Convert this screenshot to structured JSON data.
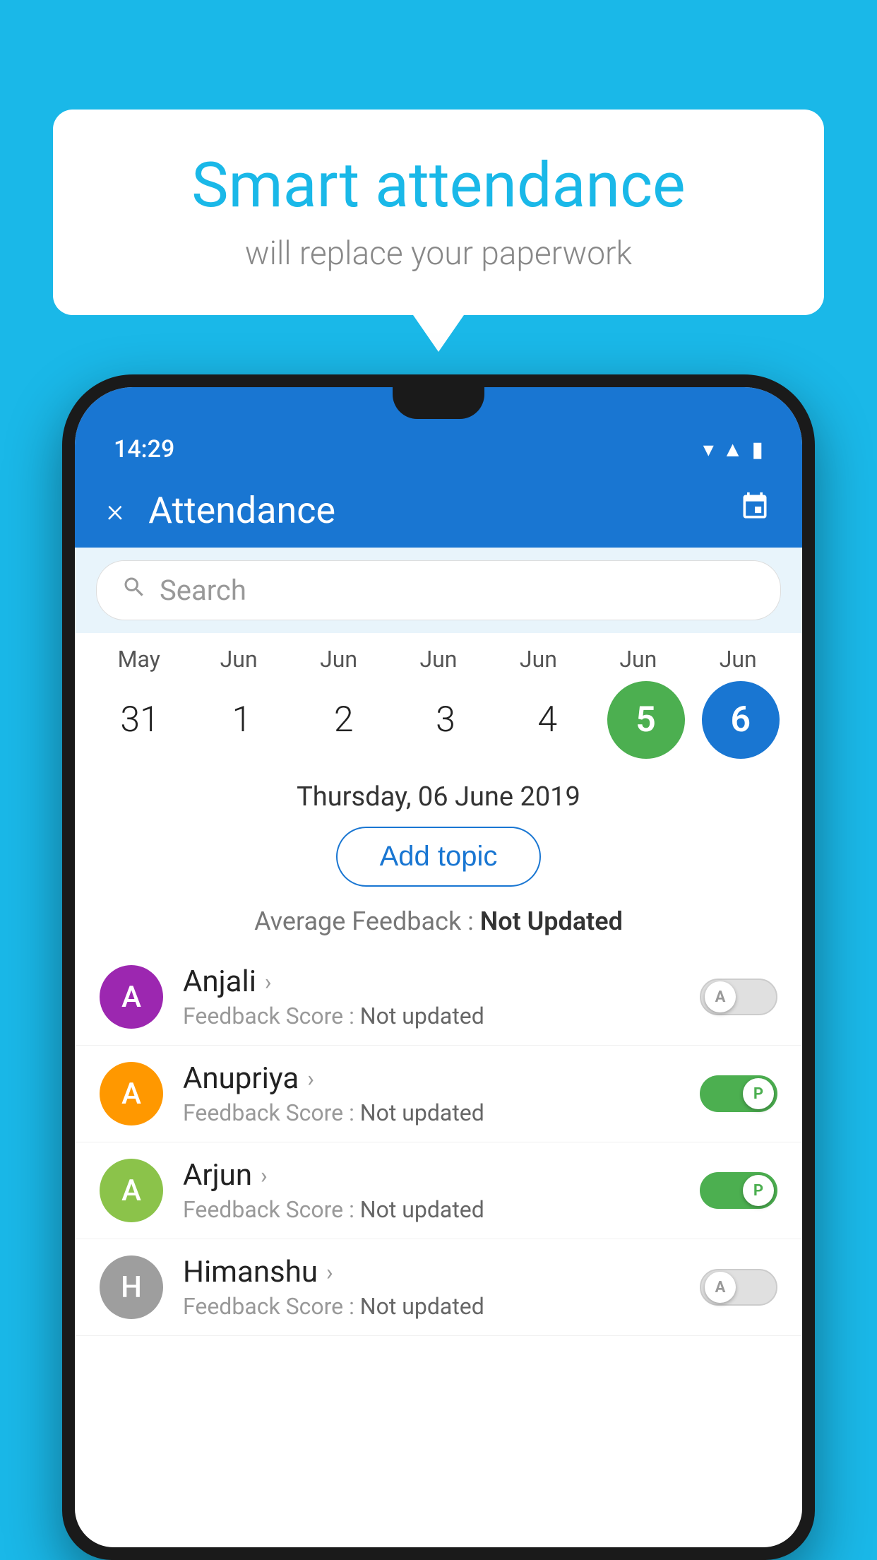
{
  "background_color": "#1ab8e8",
  "speech_bubble": {
    "title": "Smart attendance",
    "subtitle": "will replace your paperwork"
  },
  "status_bar": {
    "time": "14:29",
    "icons": [
      "wifi",
      "signal",
      "battery"
    ]
  },
  "app_bar": {
    "title": "Attendance",
    "close_label": "×",
    "calendar_icon": "📅"
  },
  "search": {
    "placeholder": "Search"
  },
  "calendar": {
    "months": [
      "May",
      "Jun",
      "Jun",
      "Jun",
      "Jun",
      "Jun",
      "Jun"
    ],
    "days": [
      "31",
      "1",
      "2",
      "3",
      "4",
      "5",
      "6"
    ],
    "active_green_index": 5,
    "active_blue_index": 6
  },
  "selected_date": "Thursday, 06 June 2019",
  "add_topic_label": "Add topic",
  "average_feedback": {
    "label": "Average Feedback :",
    "value": "Not Updated"
  },
  "students": [
    {
      "name": "Anjali",
      "initial": "A",
      "avatar_color": "#9c27b0",
      "feedback_label": "Feedback Score :",
      "feedback_value": "Not updated",
      "toggle_state": "off",
      "toggle_label": "A"
    },
    {
      "name": "Anupriya",
      "initial": "A",
      "avatar_color": "#ff9800",
      "feedback_label": "Feedback Score :",
      "feedback_value": "Not updated",
      "toggle_state": "on",
      "toggle_label": "P"
    },
    {
      "name": "Arjun",
      "initial": "A",
      "avatar_color": "#8bc34a",
      "feedback_label": "Feedback Score :",
      "feedback_value": "Not updated",
      "toggle_state": "on",
      "toggle_label": "P"
    },
    {
      "name": "Himanshu",
      "initial": "H",
      "avatar_color": "#8bc34a",
      "feedback_label": "Feedback Score :",
      "feedback_value": "Not updated",
      "toggle_state": "off",
      "toggle_label": "A"
    }
  ]
}
